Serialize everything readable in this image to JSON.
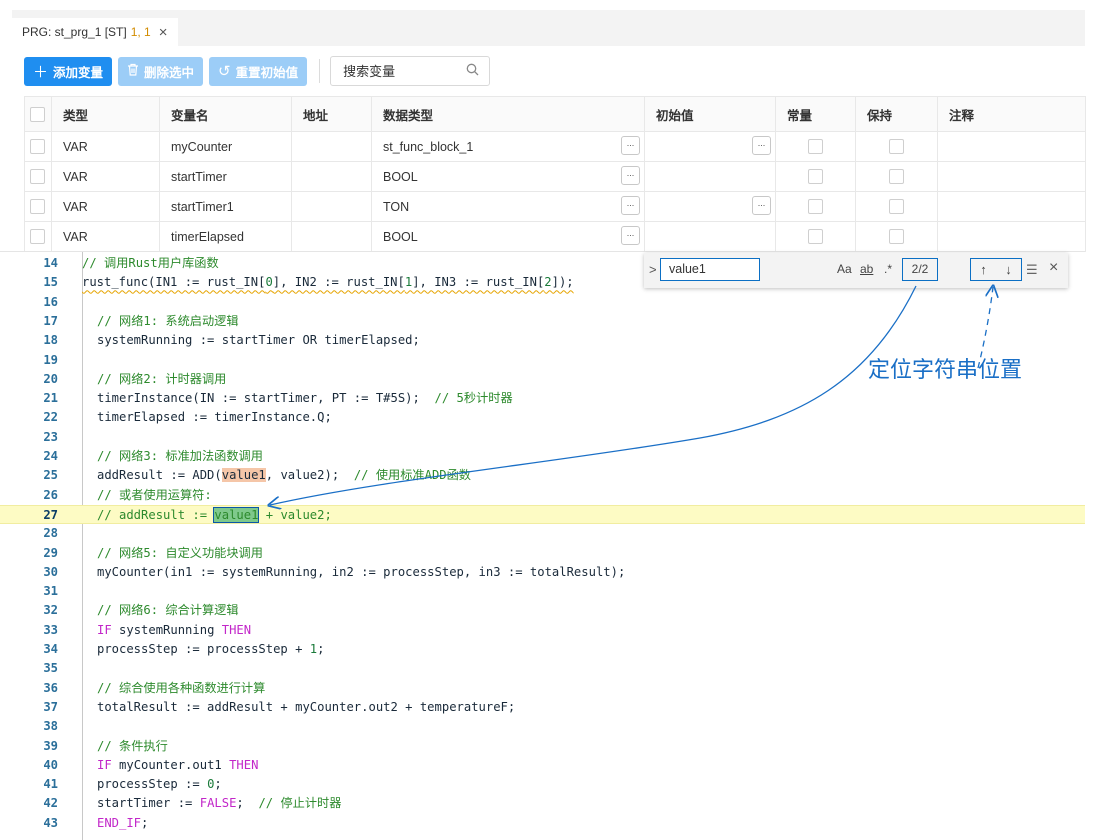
{
  "tab": {
    "title": "PRG: st_prg_1 [ST]",
    "pos": "1, 1",
    "close": "×"
  },
  "toolbar": {
    "add_label": "添加变量",
    "delete_label": "删除选中",
    "reset_label": "重置初始值",
    "search_placeholder": "搜索变量"
  },
  "table": {
    "headers": [
      "类型",
      "变量名",
      "地址",
      "数据类型",
      "初始值",
      "常量",
      "保持",
      "注释"
    ],
    "rows": [
      {
        "type": "VAR",
        "name": "myCounter",
        "address": "",
        "datatype": "st_func_block_1",
        "init_btn": true
      },
      {
        "type": "VAR",
        "name": "startTimer",
        "address": "",
        "datatype": "BOOL",
        "init_btn": false
      },
      {
        "type": "VAR",
        "name": "startTimer1",
        "address": "",
        "datatype": "TON",
        "init_btn": true
      },
      {
        "type": "VAR",
        "name": "timerElapsed",
        "address": "",
        "datatype": "BOOL",
        "init_btn": false
      }
    ],
    "dots": "..."
  },
  "code": {
    "lines": [
      {
        "n": "14",
        "text": "// 调用Rust用户库函数"
      },
      {
        "n": "15",
        "text": "rust_func(IN1 := rust_IN[0], IN2 := rust_IN[1], IN3 := rust_IN[2]);"
      },
      {
        "n": "16",
        "text": ""
      },
      {
        "n": "17",
        "text": "// 网络1: 系统启动逻辑"
      },
      {
        "n": "18",
        "text": "systemRunning := startTimer OR timerElapsed;"
      },
      {
        "n": "19",
        "text": ""
      },
      {
        "n": "20",
        "text": "// 网络2: 计时器调用"
      },
      {
        "n": "21",
        "text": "timerInstance(IN := startTimer, PT := T#5S);  // 5秒计时器"
      },
      {
        "n": "22",
        "text": "timerElapsed := timerInstance.Q;"
      },
      {
        "n": "23",
        "text": ""
      },
      {
        "n": "24",
        "text": "// 网络3: 标准加法函数调用"
      },
      {
        "n": "25",
        "text": "addResult := ADD(value1, value2);  // 使用标准ADD函数"
      },
      {
        "n": "26",
        "text": "// 或者使用运算符:"
      },
      {
        "n": "27",
        "text": "// addResult := value1 + value2;"
      },
      {
        "n": "28",
        "text": ""
      },
      {
        "n": "29",
        "text": "// 网络5: 自定义功能块调用"
      },
      {
        "n": "30",
        "text": "myCounter(in1 := systemRunning, in2 := processStep, in3 := totalResult);"
      },
      {
        "n": "31",
        "text": ""
      },
      {
        "n": "32",
        "text": "// 网络6: 综合计算逻辑"
      },
      {
        "n": "33",
        "text": "IF systemRunning THEN"
      },
      {
        "n": "34",
        "text": "processStep := processStep + 1;"
      },
      {
        "n": "35",
        "text": ""
      },
      {
        "n": "36",
        "text": "// 综合使用各种函数进行计算"
      },
      {
        "n": "37",
        "text": "totalResult := addResult + myCounter.out2 + temperatureF;"
      },
      {
        "n": "38",
        "text": ""
      },
      {
        "n": "39",
        "text": "// 条件执行"
      },
      {
        "n": "40",
        "text": "IF myCounter.out1 THEN"
      },
      {
        "n": "41",
        "text": "processStep := 0;"
      },
      {
        "n": "42",
        "text": "startTimer := FALSE;  // 停止计时器"
      },
      {
        "n": "43",
        "text": "END_IF;"
      }
    ],
    "current_line": "27"
  },
  "find": {
    "query": "value1",
    "match_case": "Aa",
    "whole_word": "ab",
    "regex": ".*",
    "count": "2/2",
    "prev": "↑",
    "next": "↓",
    "in_selection": "☰",
    "close": "×",
    "toggle": ">"
  },
  "annotation": {
    "label": "定位字符串位置"
  }
}
